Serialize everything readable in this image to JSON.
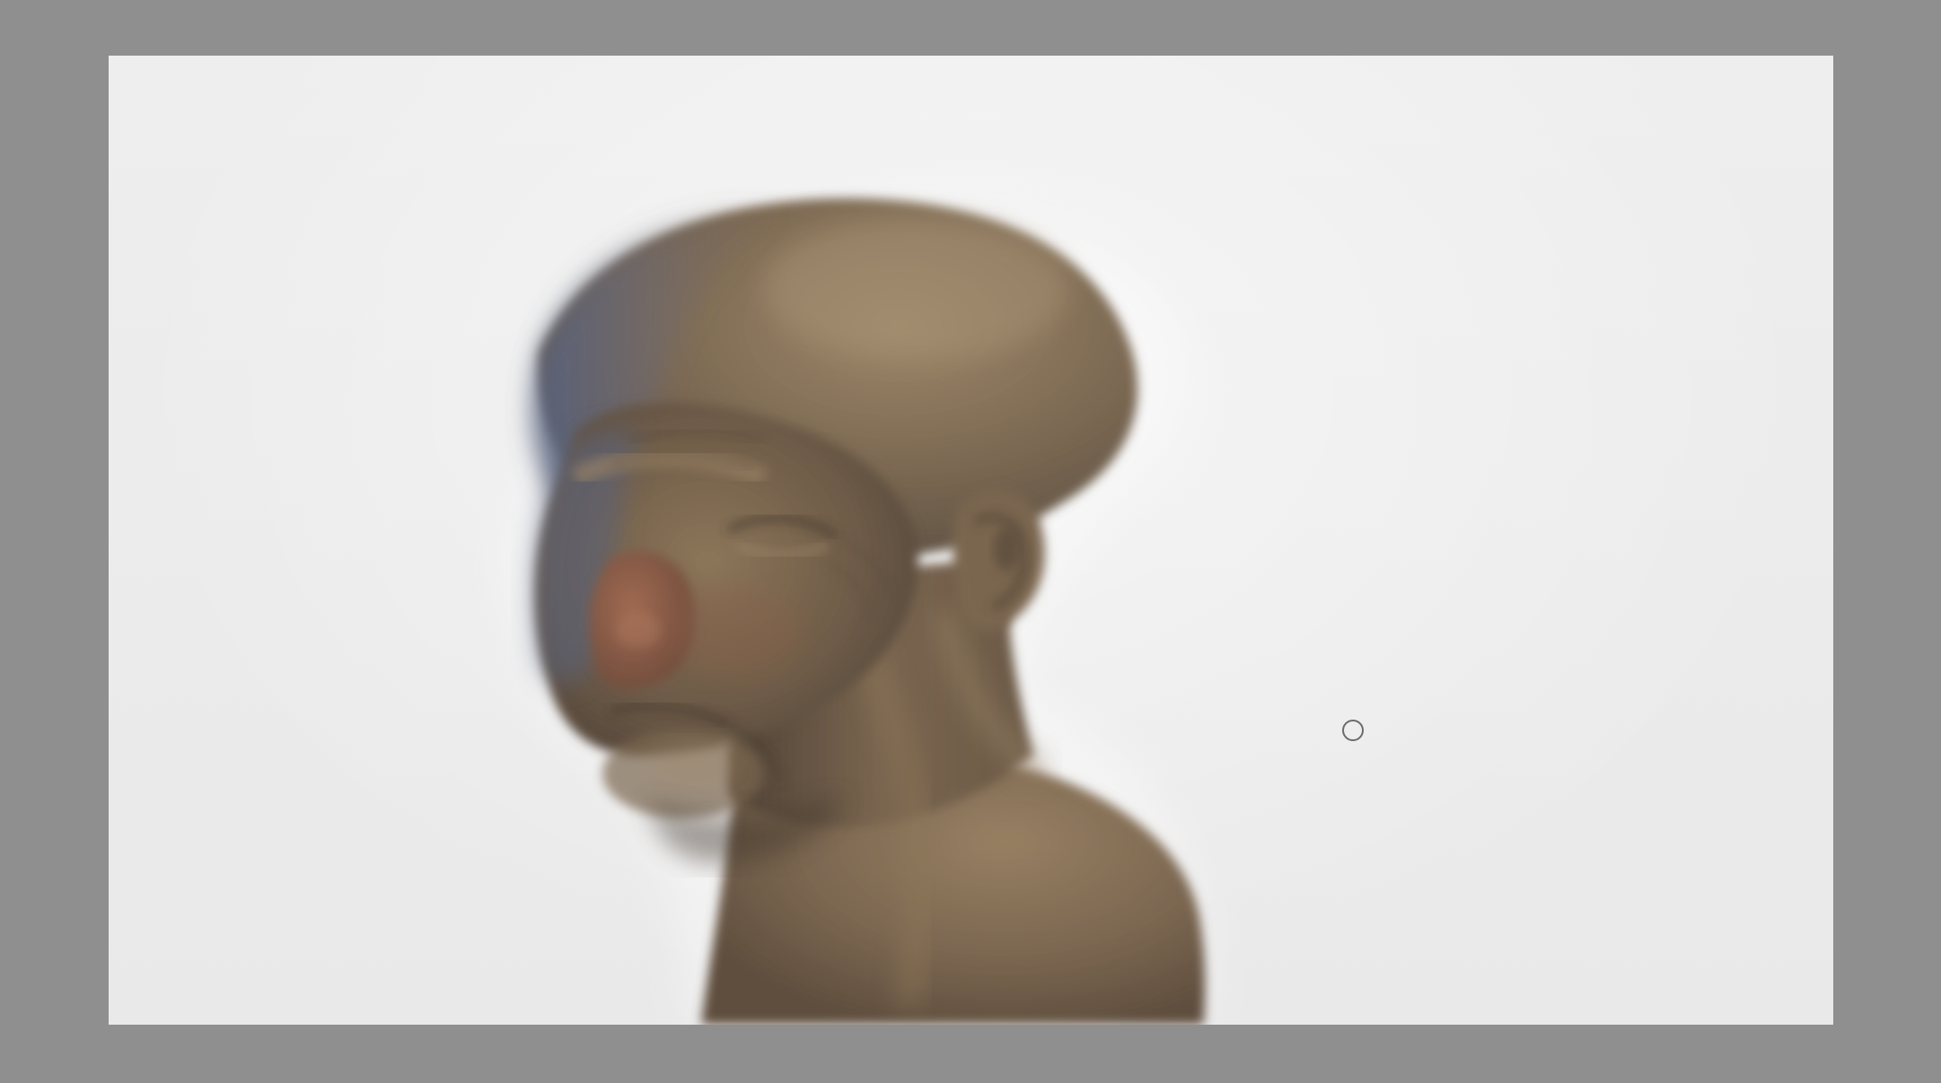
{
  "app": {
    "title": ""
  },
  "canvas": {
    "background_color": "#ededed",
    "workspace_color": "#8f8f8f",
    "subject": "creature-head-painting",
    "icons": {
      "brush_cursor": "circle-brush-cursor-icon"
    }
  },
  "colors": {
    "skin_base": "#7a6650",
    "skin_light": "#9a8468",
    "skin_shadow": "#4e3f33",
    "shadow_blue": "#5d6a86",
    "nose_warm": "#8b5b47"
  }
}
